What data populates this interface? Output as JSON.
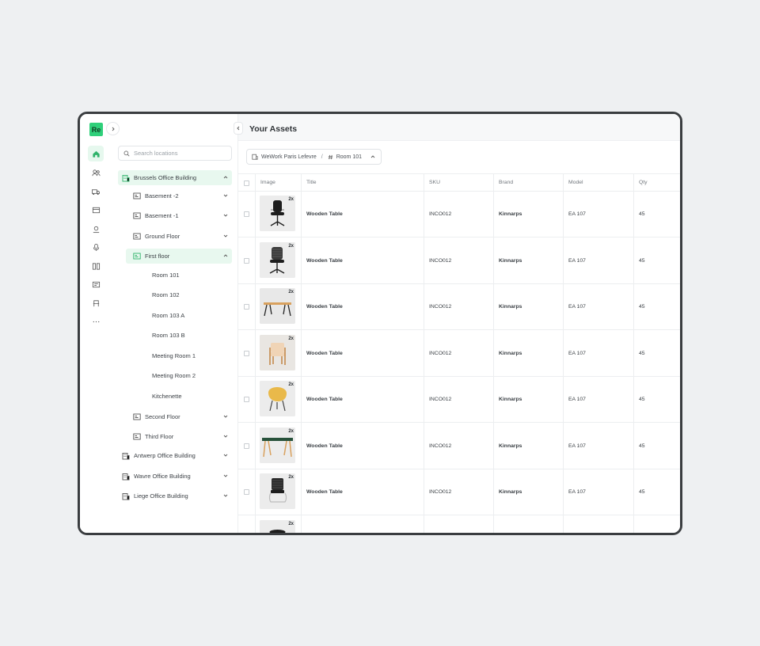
{
  "logo_text": "Re",
  "search": {
    "placeholder": "Search locations"
  },
  "locations": {
    "brussels": "Brussels Office Building",
    "floors": [
      "Basement -2",
      "Basement -1",
      "Ground Floor",
      "First floor"
    ],
    "rooms": [
      "Room 101",
      "Room 102",
      "Room 103 A",
      "Room 103 B",
      "Meeting Room 1",
      "Meeting Room 2",
      "Kitchenette"
    ],
    "floors_after": [
      "Second Floor",
      "Third Floor"
    ],
    "buildings": [
      "Antwerp Office Building",
      "Wavre Office Building",
      "Liege Office Building"
    ]
  },
  "page": {
    "title": "Your Assets"
  },
  "breadcrumb": {
    "building": "WeWork Paris Lefevre",
    "separator": "/",
    "room": "Room 101"
  },
  "table": {
    "headers": {
      "image": "Image",
      "title": "Title",
      "sku": "SKU",
      "brand": "Brand",
      "model": "Model",
      "qty": "Qty"
    },
    "rows": [
      {
        "badge": "2x",
        "thumb": "office-chair-black",
        "title": "Wooden Table",
        "sku": "INCO012",
        "brand": "Kinnarps",
        "model": "EA 107",
        "qty": "45"
      },
      {
        "badge": "2x",
        "thumb": "mesh-chair-black",
        "title": "Wooden Table",
        "sku": "INCO012",
        "brand": "Kinnarps",
        "model": "EA 107",
        "qty": "45"
      },
      {
        "badge": "2x",
        "thumb": "wooden-table",
        "title": "Wooden Table",
        "sku": "INCO012",
        "brand": "Kinnarps",
        "model": "EA 107",
        "qty": "45"
      },
      {
        "badge": "2x",
        "thumb": "wood-armchair",
        "title": "Wooden Table",
        "sku": "INCO012",
        "brand": "Kinnarps",
        "model": "EA 107",
        "qty": "45"
      },
      {
        "badge": "2x",
        "thumb": "yellow-lounge-chair",
        "title": "Wooden Table",
        "sku": "INCO012",
        "brand": "Kinnarps",
        "model": "EA 107",
        "qty": "45"
      },
      {
        "badge": "2x",
        "thumb": "green-desk",
        "title": "Wooden Table",
        "sku": "INCO012",
        "brand": "Kinnarps",
        "model": "EA 107",
        "qty": "45"
      },
      {
        "badge": "2x",
        "thumb": "cantilever-chair",
        "title": "Wooden Table",
        "sku": "INCO012",
        "brand": "Kinnarps",
        "model": "EA 107",
        "qty": "45"
      },
      {
        "badge": "2x",
        "thumb": "stool",
        "title": "",
        "sku": "",
        "brand": "",
        "model": "",
        "qty": ""
      }
    ]
  },
  "colors": {
    "accent": "#2fd07a",
    "selected_bg": "#e8f8ef",
    "frame_border": "#3a3d40"
  }
}
